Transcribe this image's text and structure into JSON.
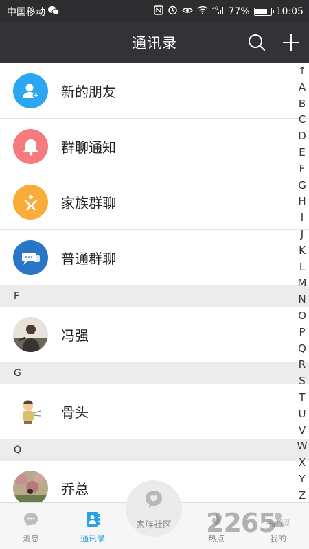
{
  "status_bar": {
    "carrier": "中国移动",
    "battery_percent": "77%",
    "battery_level": 0.77,
    "time": "10:05",
    "signal": "4G"
  },
  "header": {
    "title": "通讯录",
    "icons": [
      "search-icon",
      "plus-icon"
    ]
  },
  "top_items": [
    {
      "label": "新的朋友",
      "color": "#2ba6f0",
      "icon": "add-user-icon"
    },
    {
      "label": "群聊通知",
      "color": "#f77a7e",
      "icon": "bell-icon"
    },
    {
      "label": "家族群聊",
      "color": "#f8ac3a",
      "icon": "family-icon"
    },
    {
      "label": "普通群聊",
      "color": "#2a76c6",
      "icon": "chat-bubbles-icon"
    }
  ],
  "sections": [
    {
      "letter": "F",
      "contacts": [
        {
          "name": "冯强"
        }
      ]
    },
    {
      "letter": "G",
      "contacts": [
        {
          "name": "骨头"
        }
      ]
    },
    {
      "letter": "Q",
      "contacts": [
        {
          "name": "乔总"
        }
      ]
    }
  ],
  "index_letters": [
    "↑",
    "A",
    "B",
    "C",
    "D",
    "E",
    "F",
    "G",
    "H",
    "I",
    "J",
    "K",
    "L",
    "M",
    "N",
    "O",
    "P",
    "Q",
    "R",
    "S",
    "T",
    "U",
    "V",
    "W",
    "X",
    "Y",
    "Z"
  ],
  "tabs": [
    {
      "label": "消息",
      "icon": "message-icon",
      "active": false
    },
    {
      "label": "通讯录",
      "icon": "contacts-icon",
      "active": true
    },
    {
      "label": "家族社区",
      "icon": "heart-bubble-icon",
      "active": false
    },
    {
      "label": "热点",
      "icon": "fire-icon",
      "active": false
    },
    {
      "label": "我的",
      "icon": "profile-icon",
      "active": false
    }
  ],
  "watermark": {
    "text": "2265",
    "sub": "手游网"
  },
  "colors": {
    "header_bg": "#333337",
    "accent": "#2aa3e6"
  }
}
